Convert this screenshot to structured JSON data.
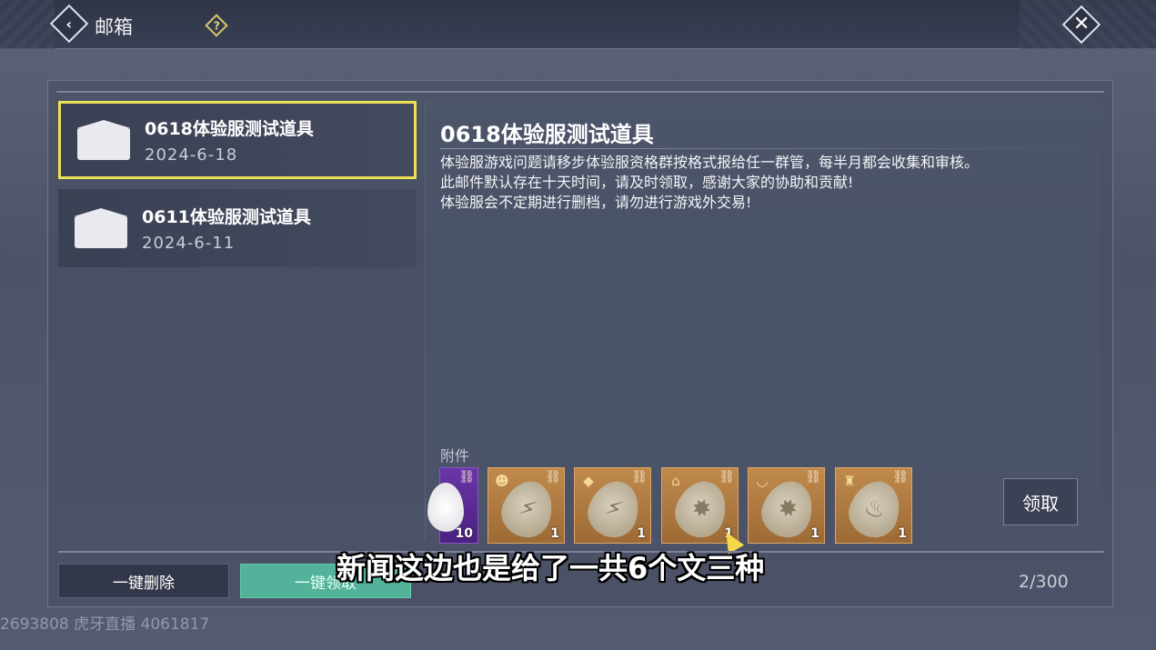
{
  "header": {
    "title": "邮箱",
    "back_icon": "chevron-left-icon",
    "help_icon": "question-icon",
    "close_icon": "close-icon",
    "back_glyph": "‹",
    "help_glyph": "?",
    "close_glyph": "✕"
  },
  "mail_list": [
    {
      "name": "0618体验服测试道具",
      "date": "2024-6-18",
      "selected": true
    },
    {
      "name": "0611体验服测试道具",
      "date": "2024-6-11",
      "selected": false
    }
  ],
  "mail_detail": {
    "title": "0618体验服测试道具",
    "body": [
      "体验服游戏问题请移步体验服资格群按格式报给任一群管，每半月都会收集和审核。",
      "此邮件默认存在十天时间，请及时领取，感谢大家的协助和贡献!",
      "体验服会不定期进行删档，请勿进行游戏外交易!"
    ],
    "attachments_label": "附件",
    "attachments": [
      {
        "qty": "10",
        "icon": "pearl-icon"
      },
      {
        "qty": "1",
        "icon": "leaf-rune-icon"
      },
      {
        "qty": "1",
        "icon": "leaf-rune-icon"
      },
      {
        "qty": "1",
        "icon": "leaf-rune-icon"
      },
      {
        "qty": "1",
        "icon": "leaf-rune-icon"
      },
      {
        "qty": "1",
        "icon": "leaf-rune-icon"
      }
    ],
    "claim_label": "领取"
  },
  "footer": {
    "delete_all_label": "一键删除",
    "claim_all_label": "一键领取",
    "count": "2/300"
  },
  "overlay": {
    "subtitle": "新闻这边也是给了一共6个文三种",
    "watermark": "2693808 虎牙直播 4061817"
  },
  "colors": {
    "selected_border": "#eedf55",
    "claim_all_bg": "#52b39a",
    "item_bg": "#b07a40",
    "purple_item_bg": "#5a2a94"
  }
}
